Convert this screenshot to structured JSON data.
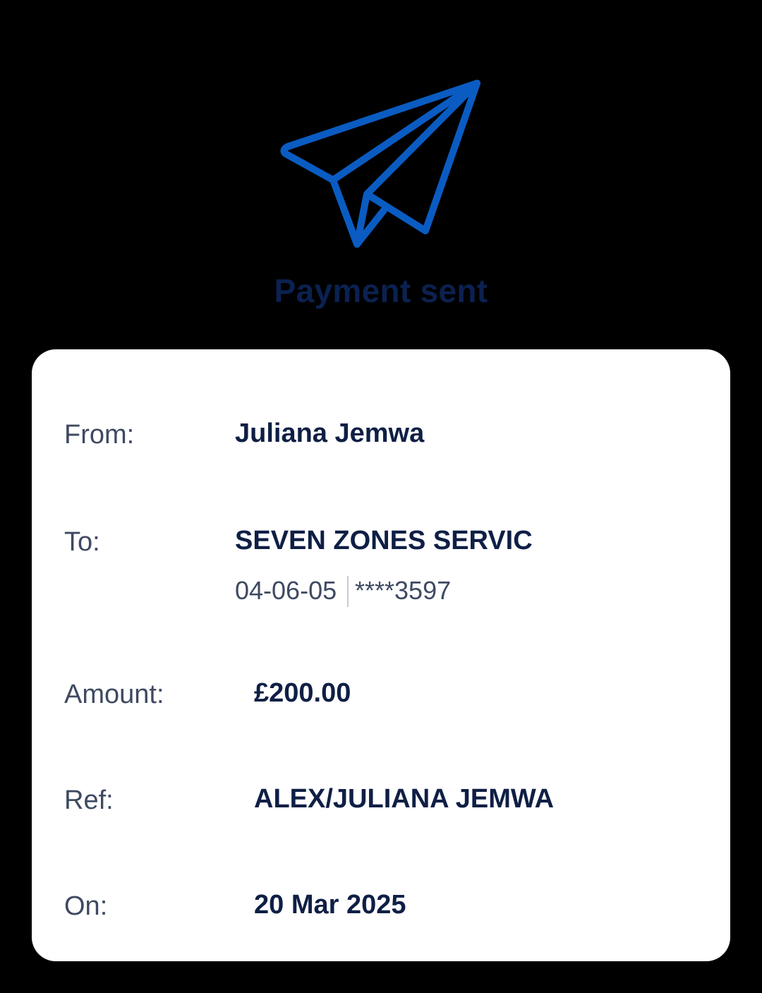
{
  "header": {
    "icon": "paper-plane-icon",
    "title": "Payment sent",
    "accent_color": "#0a5cc2",
    "title_color": "#0b2150"
  },
  "details": {
    "from": {
      "label": "From:",
      "value": "Juliana Jemwa"
    },
    "to": {
      "label": "To:",
      "value": "SEVEN ZONES SERVIC",
      "sort_code": "04-06-05",
      "account": "****3597"
    },
    "amount": {
      "label": "Amount:",
      "value": "£200.00"
    },
    "ref": {
      "label": "Ref:",
      "value": "ALEX/JULIANA JEMWA"
    },
    "on": {
      "label": "On:",
      "value": "20 Mar 2025"
    }
  }
}
